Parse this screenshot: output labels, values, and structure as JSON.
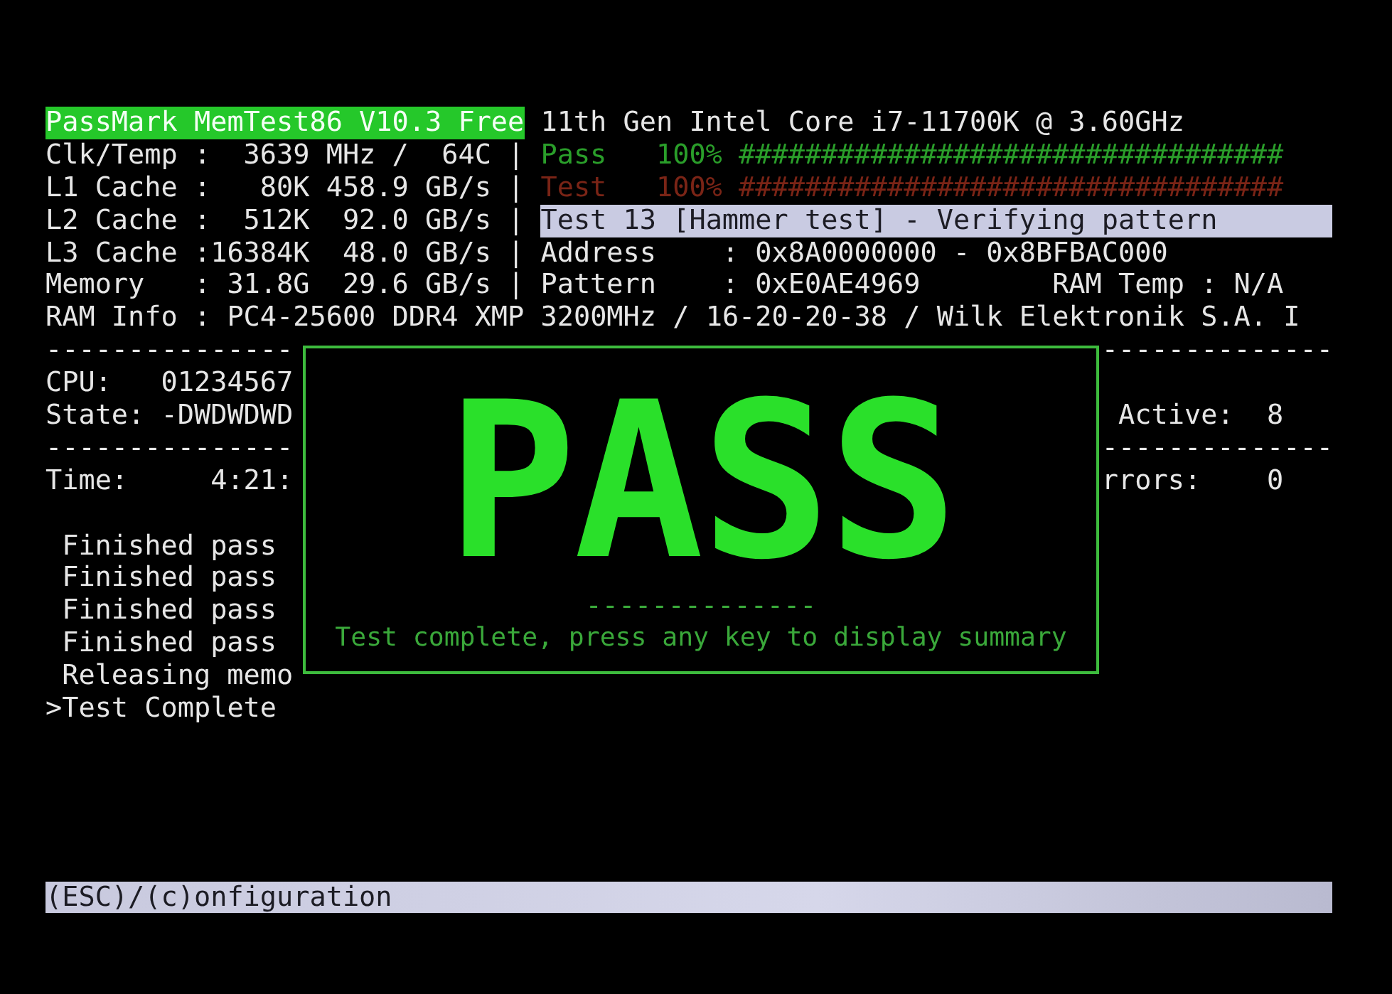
{
  "header": {
    "title": "PassMark MemTest86 V10.3 Free",
    "cpu_model": "11th Gen Intel Core i7-11700K @ 3.60GHz"
  },
  "info_rows": [
    {
      "left": "Clk/Temp :  3639 MHz /  64C |",
      "right": {
        "kind": "progress",
        "label": "Pass",
        "percent": "100%",
        "bar": "#################################",
        "color": "#2a9e2a"
      }
    },
    {
      "left": "L1 Cache :   80K 458.9 GB/s |",
      "right": {
        "kind": "progress",
        "label": "Test",
        "percent": "100%",
        "bar": "#################################",
        "color": "#7a2416"
      }
    },
    {
      "left": "L2 Cache :  512K  92.0 GB/s |",
      "right": {
        "kind": "highlight",
        "text": "Test 13 [Hammer test] - Verifying pattern"
      }
    },
    {
      "left": "L3 Cache :16384K  48.0 GB/s |",
      "right": {
        "kind": "field",
        "text": "Address    : 0x8A0000000 - 0x8BFBAC000"
      }
    },
    {
      "left": "Memory   : 31.8G  29.6 GB/s |",
      "right": {
        "kind": "field",
        "text": "Pattern    : 0xE0AE4969",
        "extra": "RAM Temp : N/A"
      }
    }
  ],
  "ram_info": "RAM Info : PC4-25600 DDR4 XMP 3200MHz / 16-20-20-38 / Wilk Elektronik S.A. I",
  "cpu_rows": [
    {
      "left": "---------------",
      "right": "--------------"
    },
    {
      "left": "CPU:   01234567"
    },
    {
      "left": "State: -DWDWDWD",
      "right": " Active:  8"
    },
    {
      "left": "---------------",
      "right": "--------------"
    },
    {
      "left": "Time:     4:21:",
      "right": "rrors:    0"
    }
  ],
  "log": [
    {
      "kind": "message",
      "text": "Finished pass"
    },
    {
      "kind": "message",
      "text": "Finished pass"
    },
    {
      "kind": "message",
      "text": "Finished pass"
    },
    {
      "kind": "message",
      "text": "Finished pass"
    },
    {
      "kind": "message",
      "text": "Releasing memo"
    },
    {
      "kind": "prompt",
      "text": ">Test Complete"
    }
  ],
  "result_popup": {
    "result": "PASS",
    "rule": "--------------",
    "message": "Test complete, press any key to display summary"
  },
  "status_bar": "(ESC)/(c)onfiguration"
}
